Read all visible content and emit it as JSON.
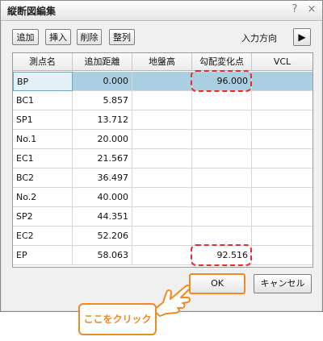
{
  "window": {
    "title": "縦断図編集",
    "help_symbol": "?",
    "close_symbol": "×"
  },
  "toolbar": {
    "add_label": "追加",
    "insert_label": "挿入",
    "delete_label": "削除",
    "sort_label": "整列",
    "direction_label": "入力方向",
    "direction_symbol": "▶"
  },
  "table": {
    "columns": [
      "測点名",
      "追加距離",
      "地盤高",
      "勾配変化点",
      "VCL"
    ],
    "rows": [
      {
        "name": "BP",
        "distance": "0.000",
        "ground": "",
        "grade_change": "96.000",
        "vcl": "",
        "selected": true
      },
      {
        "name": "BC1",
        "distance": "5.857",
        "ground": "",
        "grade_change": "",
        "vcl": ""
      },
      {
        "name": "SP1",
        "distance": "13.712",
        "ground": "",
        "grade_change": "",
        "vcl": ""
      },
      {
        "name": "No.1",
        "distance": "20.000",
        "ground": "",
        "grade_change": "",
        "vcl": ""
      },
      {
        "name": "EC1",
        "distance": "21.567",
        "ground": "",
        "grade_change": "",
        "vcl": ""
      },
      {
        "name": "BC2",
        "distance": "36.497",
        "ground": "",
        "grade_change": "",
        "vcl": ""
      },
      {
        "name": "No.2",
        "distance": "40.000",
        "ground": "",
        "grade_change": "",
        "vcl": ""
      },
      {
        "name": "SP2",
        "distance": "44.351",
        "ground": "",
        "grade_change": "",
        "vcl": ""
      },
      {
        "name": "EC2",
        "distance": "52.206",
        "ground": "",
        "grade_change": "",
        "vcl": ""
      },
      {
        "name": "EP",
        "distance": "58.063",
        "ground": "",
        "grade_change": "92.516",
        "vcl": ""
      }
    ]
  },
  "footer": {
    "ok_label": "OK",
    "cancel_label": "キャンセル"
  },
  "annotation": {
    "callout_text": "ここをクリック",
    "highlight_color": "#e03030",
    "callout_color": "#f08a24"
  }
}
